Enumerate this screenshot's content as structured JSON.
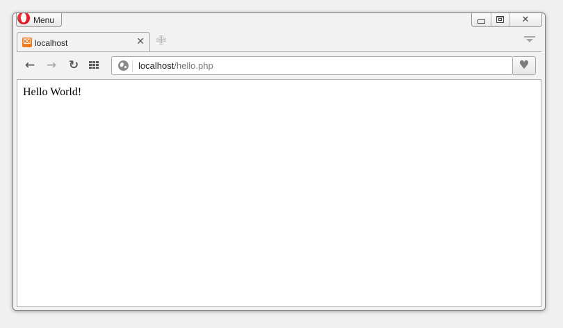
{
  "menu": {
    "label": "Menu"
  },
  "tab": {
    "title": "localhost",
    "favicon_glyph": "⌧",
    "favicon_color": "#f07b1c"
  },
  "address": {
    "host": "localhost",
    "path": "/hello.php"
  },
  "page": {
    "text": "Hello World!"
  },
  "icons": {
    "back": "←",
    "forward": "→",
    "reload": "↻",
    "close": "✕",
    "new_tab": "✙",
    "favorite": "♥",
    "window_close": "✕"
  }
}
